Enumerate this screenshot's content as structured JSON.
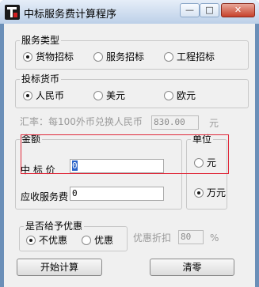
{
  "window": {
    "title": "中标服务费计算程序",
    "min_label": "—",
    "max_label": "□",
    "close_label": "✕"
  },
  "service_type": {
    "legend": "服务类型",
    "options": [
      {
        "label": "货物招标",
        "checked": true
      },
      {
        "label": "服务招标",
        "checked": false
      },
      {
        "label": "工程招标",
        "checked": false
      }
    ]
  },
  "currency": {
    "legend": "投标货币",
    "options": [
      {
        "label": "人民币",
        "checked": true
      },
      {
        "label": "美元",
        "checked": false
      },
      {
        "label": "欧元",
        "checked": false
      }
    ]
  },
  "exchange_rate": {
    "label": "汇率：每100外币兑换人民币",
    "value": "830.00",
    "unit": "元"
  },
  "amount": {
    "legend": "金额",
    "bid_price_label": "中  标  价",
    "bid_price_value": "0",
    "service_fee_label": "应收服务费",
    "service_fee_value": "0"
  },
  "unit": {
    "legend": "单位",
    "options": [
      {
        "label": "元",
        "checked": false
      },
      {
        "label": "万元",
        "checked": true
      }
    ]
  },
  "discount": {
    "legend": "是否给予优惠",
    "options": [
      {
        "label": "不优惠",
        "checked": true
      },
      {
        "label": "优惠",
        "checked": false
      }
    ],
    "rate_label": "优惠折扣",
    "rate_value": "80",
    "rate_unit": "%"
  },
  "buttons": {
    "start": "开始计算",
    "clear": "清零"
  }
}
